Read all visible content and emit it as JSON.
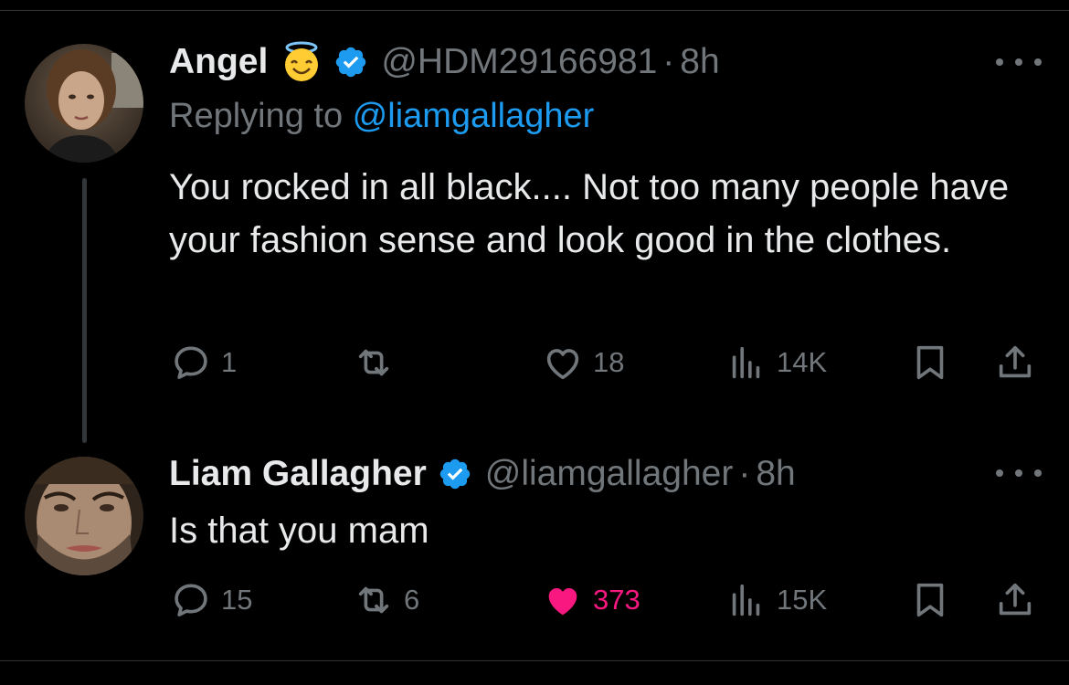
{
  "reply_to_tweet": {
    "author_name": "Angel",
    "author_emoji": "smiling-face-with-halo",
    "handle": "@HDM29166981",
    "separator": "·",
    "time": "8h",
    "replying_prefix": "Replying to ",
    "replying_mention": "@liamgallagher",
    "text": "You rocked in all black.... Not too many people have your fashion sense and look good in the clothes.",
    "stats": {
      "replies": "1",
      "retweets": "",
      "likes": "18",
      "views": "14K"
    }
  },
  "main_tweet": {
    "author_name": "Liam Gallagher",
    "handle": "@liamgallagher",
    "separator": "·",
    "time": "8h",
    "text": "Is that you mam",
    "stats": {
      "replies": "15",
      "retweets": "6",
      "likes": "373",
      "views": "15K"
    },
    "liked": true
  },
  "colors": {
    "background": "#000000",
    "text_primary": "#e7e9ea",
    "text_secondary": "#71767b",
    "accent_blue": "#1d9bf0",
    "like_pink": "#f91880",
    "divider": "#2f3336"
  }
}
